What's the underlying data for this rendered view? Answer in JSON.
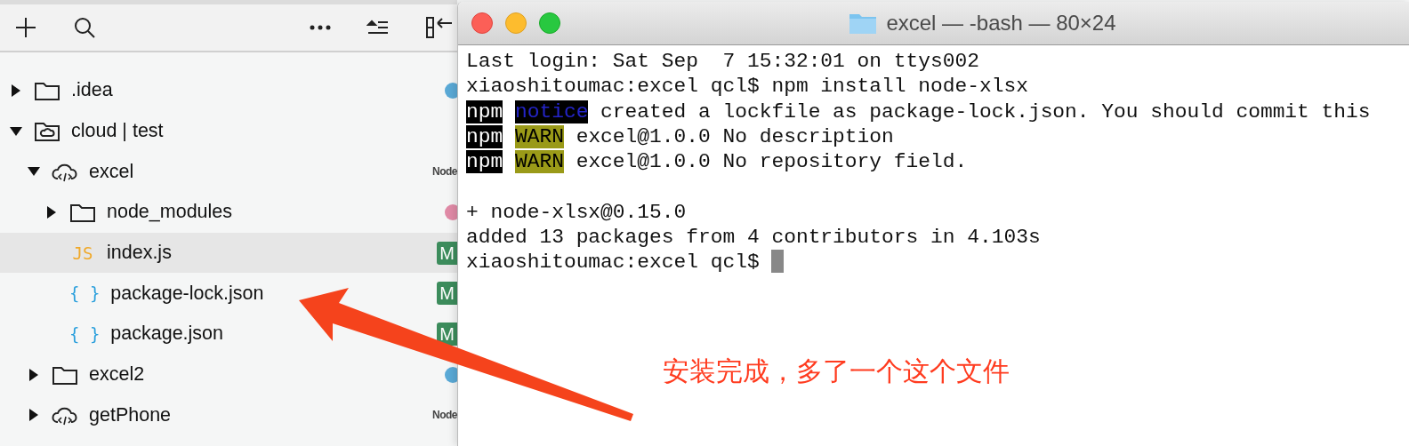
{
  "sidebar": {
    "toolbar": [
      {
        "kind": "add"
      },
      {
        "kind": "search"
      },
      {
        "kind": "more"
      },
      {
        "kind": "collapse"
      },
      {
        "kind": "split"
      }
    ],
    "tree": [
      {
        "label": ".idea",
        "kind": "folder",
        "expanded": false,
        "selected": false,
        "badge": {
          "kind": "dot",
          "color": "#5aa9d6"
        }
      },
      {
        "label": "cloud | test",
        "kind": "cloud-folder",
        "expanded": true,
        "selected": false,
        "children": [
          {
            "label": "excel",
            "kind": "cloud-code",
            "expanded": true,
            "selected": false,
            "badge": {
              "kind": "node",
              "text": "Node"
            },
            "children": [
              {
                "label": "node_modules",
                "kind": "folder",
                "expanded": false,
                "selected": false,
                "badge": {
                  "kind": "dot",
                  "color": "#e08aa6"
                }
              },
              {
                "label": "index.js",
                "kind": "js",
                "icon_text": "JS",
                "selected": true,
                "badge": {
                  "kind": "letter",
                  "text": "M"
                }
              },
              {
                "label": "package-lock.json",
                "kind": "json",
                "icon_text": "{ }",
                "selected": false,
                "badge": {
                  "kind": "letter",
                  "text": "M"
                }
              },
              {
                "label": "package.json",
                "kind": "json",
                "icon_text": "{ }",
                "selected": false,
                "badge": {
                  "kind": "letter",
                  "text": "M"
                }
              }
            ]
          },
          {
            "label": "excel2",
            "kind": "folder",
            "expanded": false,
            "selected": false,
            "badge": {
              "kind": "dot",
              "color": "#5aa9d6"
            }
          },
          {
            "label": "getPhone",
            "kind": "cloud-code",
            "expanded": false,
            "selected": false,
            "badge": {
              "kind": "node",
              "text": "Node"
            }
          }
        ]
      }
    ]
  },
  "terminal": {
    "title": "excel — -bash — 80×24",
    "lines": [
      {
        "kind": "text",
        "segments": [
          {
            "kind": "plain",
            "text": "Last login: Sat Sep  7 15:32:01 on ttys002"
          }
        ]
      },
      {
        "kind": "text",
        "segments": [
          {
            "kind": "plain",
            "text": "xiaoshitoumac:excel qcl$ npm install node-xlsx"
          }
        ]
      },
      {
        "kind": "text",
        "segments": [
          {
            "kind": "npm",
            "text": "npm"
          },
          {
            "kind": "notice",
            "text": "notice"
          },
          {
            "kind": "plain",
            "text": " created a lockfile as package-lock.json. You should commit this"
          }
        ]
      },
      {
        "kind": "text",
        "segments": [
          {
            "kind": "npm",
            "text": "npm"
          },
          {
            "kind": "warn",
            "text": "WARN"
          },
          {
            "kind": "plain",
            "text": " excel@1.0.0 No description"
          }
        ]
      },
      {
        "kind": "text",
        "segments": [
          {
            "kind": "npm",
            "text": "npm"
          },
          {
            "kind": "warn",
            "text": "WARN"
          },
          {
            "kind": "plain",
            "text": " excel@1.0.0 No repository field."
          }
        ]
      },
      {
        "kind": "blank"
      },
      {
        "kind": "text",
        "segments": [
          {
            "kind": "plain",
            "text": "+ node-xlsx@0.15.0"
          }
        ]
      },
      {
        "kind": "text",
        "segments": [
          {
            "kind": "plain",
            "text": "added 13 packages from 4 contributors in 4.103s"
          }
        ]
      },
      {
        "kind": "text",
        "segments": [
          {
            "kind": "plain",
            "text": "xiaoshitoumac:excel qcl$ "
          },
          {
            "kind": "cursor"
          }
        ]
      }
    ]
  },
  "annotation": {
    "text": "安装完成，多了一个这个文件"
  }
}
